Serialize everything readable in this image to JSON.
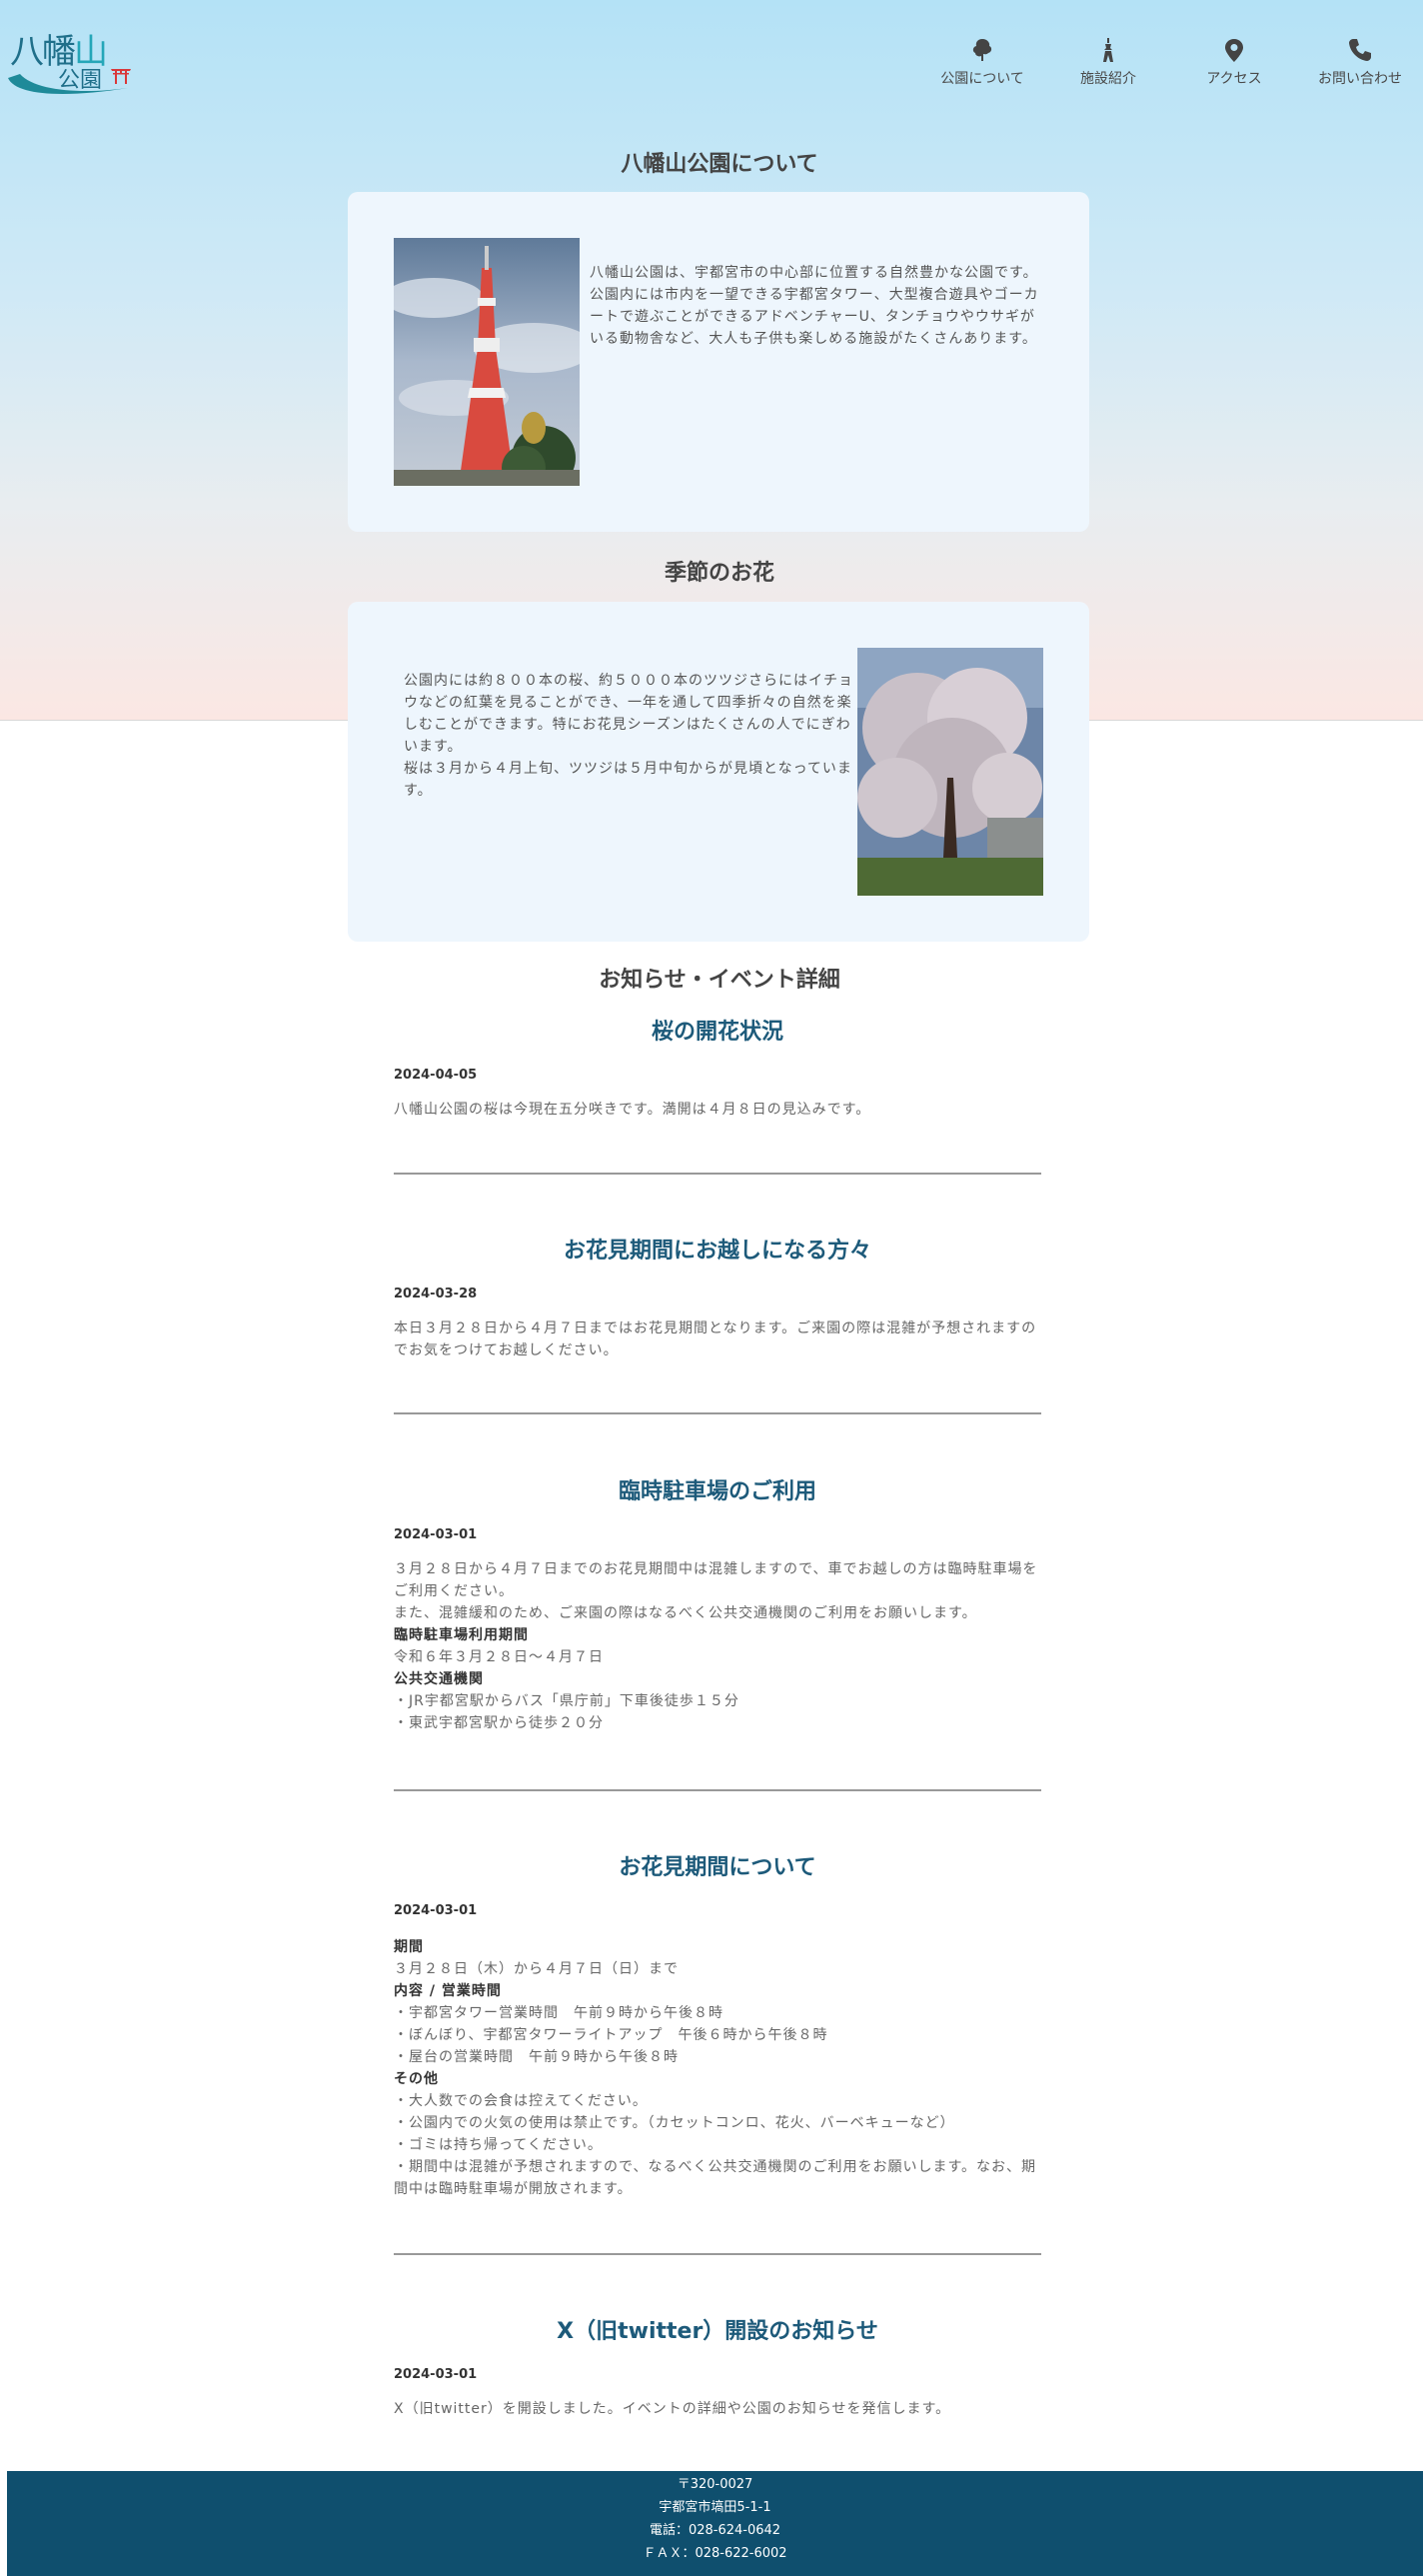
{
  "logo": {
    "line1a": "八幡",
    "line1b": "山",
    "line2": "公園",
    "torii": "⛩"
  },
  "nav": [
    {
      "label": "公園について",
      "icon": "tree-icon"
    },
    {
      "label": "施設紹介",
      "icon": "tower-icon"
    },
    {
      "label": "アクセス",
      "icon": "map-pin-icon"
    },
    {
      "label": "お問い合わせ",
      "icon": "phone-icon"
    }
  ],
  "about": {
    "title": "八幡山公園について",
    "text": "八幡山公園は、宇都宮市の中心部に位置する自然豊かな公園です。公園内には市内を一望できる宇都宮タワー、大型複合遊具やゴーカートで遊ぶことができるアドベンチャーU、タンチョウやウサギがいる動物舎など、大人も子供も楽しめる施設がたくさんあります。"
  },
  "flowers": {
    "title": "季節のお花",
    "text1": "公園内には約８００本の桜、約５０００本のツツジさらにはイチョウなどの紅葉を見ることができ、一年を通して四季折々の自然を楽しむことができます。特にお花見シーズンはたくさんの人でにぎわいます。",
    "text2": "桜は３月から４月上旬、ツツジは５月中旬からが見頃となっています。"
  },
  "news_heading": "お知らせ・イベント詳細",
  "news": [
    {
      "title": "桜の開花状況",
      "date": "2024-04-05",
      "lines": [
        "八幡山公園の桜は今現在五分咲きです。満開は４月８日の見込みです。"
      ]
    },
    {
      "title": "お花見期間にお越しになる方々",
      "date": "2024-03-28",
      "lines": [
        "本日３月２８日から４月７日まではお花見期間となります。ご来園の際は混雑が予想されますのでお気をつけてお越しください。"
      ]
    },
    {
      "title": "臨時駐車場のご利用",
      "date": "2024-03-01",
      "lines": [
        "３月２８日から４月７日までのお花見期間中は混雑しますので、車でお越しの方は臨時駐車場をご利用ください。",
        "また、混雑緩和のため、ご来園の際はなるべく公共交通機関のご利用をお願いします。",
        "臨時駐車場利用期間",
        "令和６年３月２８日～４月７日",
        "公共交通機関",
        "・JR宇都宮駅からバス「県庁前」下車後徒歩１５分",
        "・東武宇都宮駅から徒歩２０分"
      ]
    },
    {
      "title": "お花見期間について",
      "date": "2024-03-01",
      "lines": [
        "期間",
        "３月２８日（木）から４月７日（日）まで",
        "内容 / 営業時間",
        "・宇都宮タワー営業時間　午前９時から午後８時",
        "・ぼんぼり、宇都宮タワーライトアップ　午後６時から午後８時",
        "・屋台の営業時間　午前９時から午後８時",
        "その他",
        "・大人数での会食は控えてください。",
        "・公園内での火気の使用は禁止です。（カセットコンロ、花火、バーベキューなど）",
        "・ゴミは持ち帰ってください。",
        "・期間中は混雑が予想されますので、なるべく公共交通機関のご利用をお願いします。なお、期間中は臨時駐車場が開放されます。"
      ]
    },
    {
      "title": "X（旧twitter）開設のお知らせ",
      "date": "2024-03-01",
      "lines": [
        "X（旧twitter）を開設しました。イベントの詳細や公園のお知らせを発信します。"
      ]
    }
  ],
  "footer": {
    "postal": "〒320-0027",
    "address": "宇都宮市塙田5-1-1",
    "tel": "電話：028-624-0642",
    "fax": "ＦＡＸ：028-622-6002"
  },
  "colors": {
    "accent": "#1d5a7a",
    "footer": "#0f4f6e",
    "card": "#eef6fd"
  }
}
